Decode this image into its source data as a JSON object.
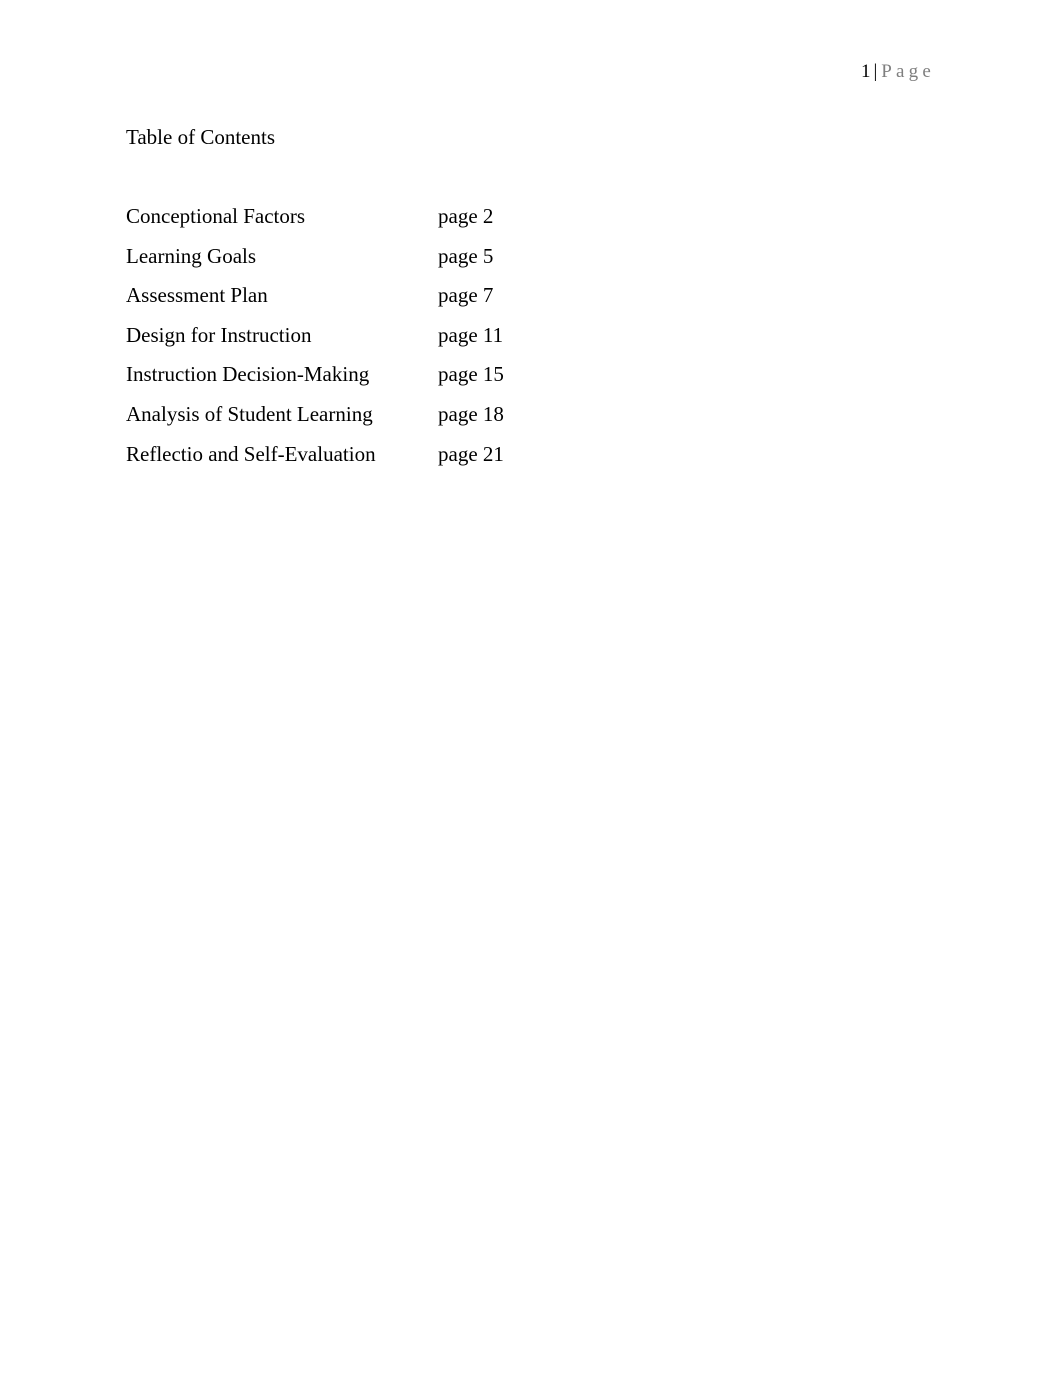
{
  "header": {
    "page_number": "1",
    "separator": "|",
    "page_word": "Page"
  },
  "title": "Table of Contents",
  "toc": [
    {
      "label": "Conceptional Factors",
      "page": "page 2"
    },
    {
      "label": "Learning Goals",
      "page": "page 5"
    },
    {
      "label": "Assessment Plan",
      "page": "page 7"
    },
    {
      "label": "Design for Instruction",
      "page": "page 11"
    },
    {
      "label": "Instruction Decision-Making",
      "page": "page 15"
    },
    {
      "label": "Analysis of Student Learning",
      "page": "page 18"
    },
    {
      "label": "Reflectio and Self-Evaluation",
      "page": "page 21"
    }
  ]
}
